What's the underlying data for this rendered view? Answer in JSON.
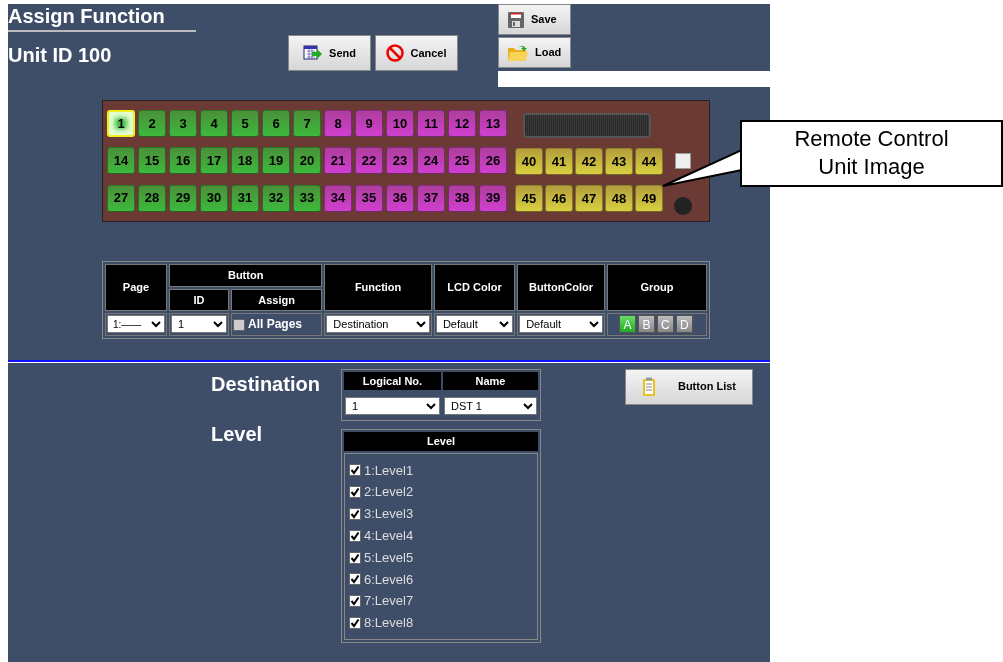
{
  "header": {
    "title": "Assign Function",
    "unit_id": "Unit ID 100"
  },
  "actions": [
    {
      "label": "Send",
      "kind": "send"
    },
    {
      "label": "Cancel",
      "kind": "cancel"
    }
  ],
  "file_buttons": [
    {
      "label": "Save",
      "kind": "save"
    },
    {
      "label": "Load",
      "kind": "load"
    }
  ],
  "remote_unit": {
    "button_rows": [
      [
        {
          "label": "1",
          "color": "#3cba3c",
          "selected": true
        },
        {
          "label": "2",
          "color": "#3cba3c",
          "selected": false
        },
        {
          "label": "3",
          "color": "#3cba3c",
          "selected": false
        },
        {
          "label": "4",
          "color": "#3cba3c",
          "selected": false
        },
        {
          "label": "5",
          "color": "#3cba3c",
          "selected": false
        },
        {
          "label": "6",
          "color": "#3cba3c",
          "selected": false
        },
        {
          "label": "7",
          "color": "#3cba3c",
          "selected": false
        },
        {
          "label": "8",
          "color": "#d040d0",
          "selected": false
        },
        {
          "label": "9",
          "color": "#d040d0",
          "selected": false
        },
        {
          "label": "10",
          "color": "#d040d0",
          "selected": false
        },
        {
          "label": "11",
          "color": "#d040d0",
          "selected": false
        },
        {
          "label": "12",
          "color": "#d040d0",
          "selected": false
        },
        {
          "label": "13",
          "color": "#d040d0",
          "selected": false
        }
      ],
      [
        {
          "label": "14",
          "color": "#3cba3c",
          "selected": false
        },
        {
          "label": "15",
          "color": "#3cba3c",
          "selected": false
        },
        {
          "label": "16",
          "color": "#3cba3c",
          "selected": false
        },
        {
          "label": "17",
          "color": "#3cba3c",
          "selected": false
        },
        {
          "label": "18",
          "color": "#3cba3c",
          "selected": false
        },
        {
          "label": "19",
          "color": "#3cba3c",
          "selected": false
        },
        {
          "label": "20",
          "color": "#3cba3c",
          "selected": false
        },
        {
          "label": "21",
          "color": "#d040d0",
          "selected": false
        },
        {
          "label": "22",
          "color": "#d040d0",
          "selected": false
        },
        {
          "label": "23",
          "color": "#d040d0",
          "selected": false
        },
        {
          "label": "24",
          "color": "#d040d0",
          "selected": false
        },
        {
          "label": "25",
          "color": "#d040d0",
          "selected": false
        },
        {
          "label": "26",
          "color": "#d040d0",
          "selected": false
        }
      ],
      [
        {
          "label": "27",
          "color": "#3cba3c",
          "selected": false
        },
        {
          "label": "28",
          "color": "#3cba3c",
          "selected": false
        },
        {
          "label": "29",
          "color": "#3cba3c",
          "selected": false
        },
        {
          "label": "30",
          "color": "#3cba3c",
          "selected": false
        },
        {
          "label": "31",
          "color": "#3cba3c",
          "selected": false
        },
        {
          "label": "32",
          "color": "#3cba3c",
          "selected": false
        },
        {
          "label": "33",
          "color": "#3cba3c",
          "selected": false
        },
        {
          "label": "34",
          "color": "#d040d0",
          "selected": false
        },
        {
          "label": "35",
          "color": "#d040d0",
          "selected": false
        },
        {
          "label": "36",
          "color": "#d040d0",
          "selected": false
        },
        {
          "label": "37",
          "color": "#d040d0",
          "selected": false
        },
        {
          "label": "38",
          "color": "#d040d0",
          "selected": false
        },
        {
          "label": "39",
          "color": "#d040d0",
          "selected": false
        }
      ]
    ],
    "side_rows": [
      [
        {
          "label": "40",
          "color": "#d8d040",
          "selected": false
        },
        {
          "label": "41",
          "color": "#d8d040",
          "selected": false
        },
        {
          "label": "42",
          "color": "#d8d040",
          "selected": false
        },
        {
          "label": "43",
          "color": "#d8d040",
          "selected": false
        },
        {
          "label": "44",
          "color": "#d8d040",
          "selected": false
        }
      ],
      [
        {
          "label": "45",
          "color": "#d8d040",
          "selected": false
        },
        {
          "label": "46",
          "color": "#d8d040",
          "selected": false
        },
        {
          "label": "47",
          "color": "#d8d040",
          "selected": false
        },
        {
          "label": "48",
          "color": "#d8d040",
          "selected": false
        },
        {
          "label": "49",
          "color": "#d8d040",
          "selected": false
        }
      ]
    ]
  },
  "assign_table": {
    "page_header": "Page",
    "button_header": "Button",
    "id_header": "ID",
    "assign_header": "Assign",
    "function_header": "Function",
    "lcd_header": "LCD Color",
    "color_header": "ButtonColor",
    "group_header": "Group",
    "page": "1:——",
    "id": "1",
    "all_pages": {
      "label": "All Pages",
      "checked": false
    },
    "function": "Destination",
    "lcd_color": "Default",
    "button_color": "Default",
    "groups": [
      {
        "label": "A",
        "selected": true
      },
      {
        "label": "B",
        "selected": false
      },
      {
        "label": "C",
        "selected": false
      },
      {
        "label": "D",
        "selected": false
      }
    ]
  },
  "destination": {
    "label": "Destination",
    "logical_header": "Logical No.",
    "name_header": "Name",
    "logical_no": "1",
    "name": "DST 1"
  },
  "button_list": "Button List",
  "level": {
    "label": "Level",
    "header": "Level",
    "items": [
      {
        "label": "1:Level1",
        "checked": true
      },
      {
        "label": "2:Level2",
        "checked": true
      },
      {
        "label": "3:Level3",
        "checked": true
      },
      {
        "label": "4:Level4",
        "checked": true
      },
      {
        "label": "5:Level5",
        "checked": true
      },
      {
        "label": "6:Level6",
        "checked": true
      },
      {
        "label": "7:Level7",
        "checked": true
      },
      {
        "label": "8:Level8",
        "checked": true
      }
    ]
  },
  "callout": "Remote Control Unit Image"
}
